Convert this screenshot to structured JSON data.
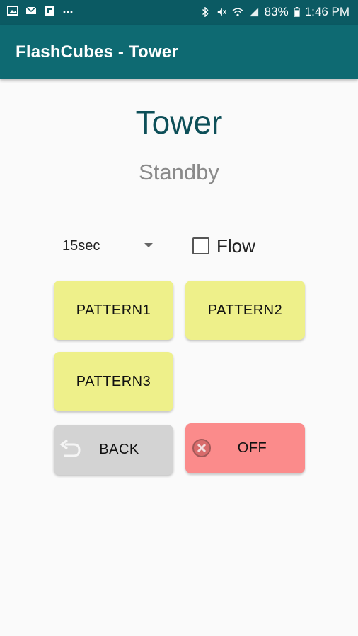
{
  "status_bar": {
    "battery": "83%",
    "time": "1:46 PM",
    "left_icons": [
      "image-icon",
      "mail-icon",
      "flipboard-icon",
      "more-dots-icon"
    ],
    "right_icons": [
      "bluetooth-icon",
      "mute-icon",
      "wifi-icon",
      "signal-icon",
      "battery-icon"
    ]
  },
  "app_bar": {
    "title": "FlashCubes - Tower"
  },
  "main": {
    "heading": "Tower",
    "status": "Standby",
    "interval": {
      "selected": "15sec"
    },
    "flow_checkbox": {
      "label": "Flow",
      "checked": false
    },
    "buttons": {
      "pattern1": "PATTERN1",
      "pattern2": "PATTERN2",
      "pattern3": "PATTERN3",
      "back": "BACK",
      "off": "OFF"
    }
  },
  "colors": {
    "status_bar": "#0b5a63",
    "app_bar": "#0e6a72",
    "pattern_button": "#eef08a",
    "back_button": "#d3d3d3",
    "off_button": "#fb8b8b"
  }
}
